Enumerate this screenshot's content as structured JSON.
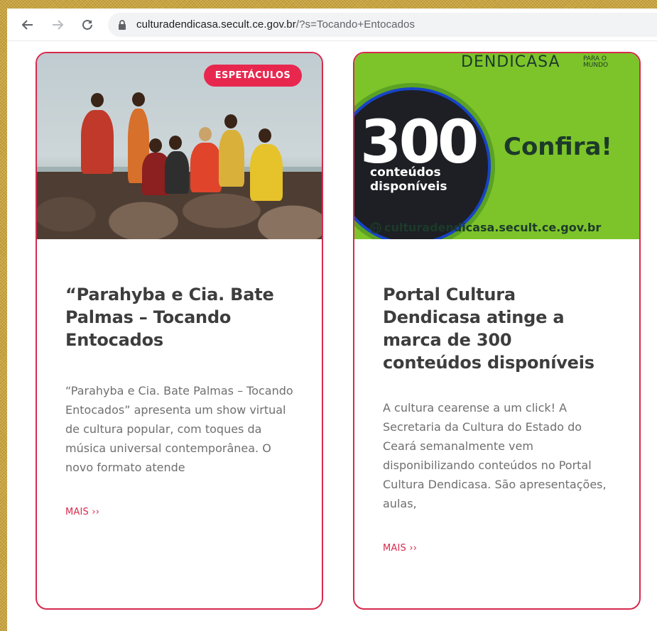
{
  "browser": {
    "url_domain": "culturadendicasa.secult.ce.gov.br",
    "url_path": "/?s=Tocando+Entocados",
    "icons": [
      "back-arrow-icon",
      "forward-arrow-icon",
      "reload-icon",
      "lock-icon"
    ]
  },
  "cards": [
    {
      "category_badge": "ESPETÁCULOS",
      "title": "“Parahyba e Cia. Bate Palmas – Tocando Entocados",
      "excerpt": "“Parahyba e Cia. Bate Palmas – Tocando Entocados” apresenta um show virtual de cultura popular, com toques da música universal contemporânea. O novo formato atende",
      "more_label": "MAIS ››"
    },
    {
      "image": {
        "brand": "DENDICASA",
        "brand_sub_1": "PARA O",
        "brand_sub_2": "MUNDO",
        "number": "300",
        "number_sub_1": "conteúdos",
        "number_sub_2": "disponíveis",
        "cta": "Confira!",
        "site": "culturadendicasa.secult.ce.gov.br"
      },
      "title": "Portal Cultura Dendicasa atinge a marca de 300 conteúdos disponíveis",
      "excerpt": "A cultura cearense a um click! A Secretaria da Cultura do Estado do Ceará semanalmente vem disponibilizando conteúdos no Portal Cultura Dendicasa. São apresentações, aulas,",
      "more_label": "MAIS ››"
    }
  ],
  "colors": {
    "accent": "#d62a4d",
    "badge": "#e8274f",
    "promo_green": "#7dc42a",
    "frame": "#c9a53f"
  }
}
